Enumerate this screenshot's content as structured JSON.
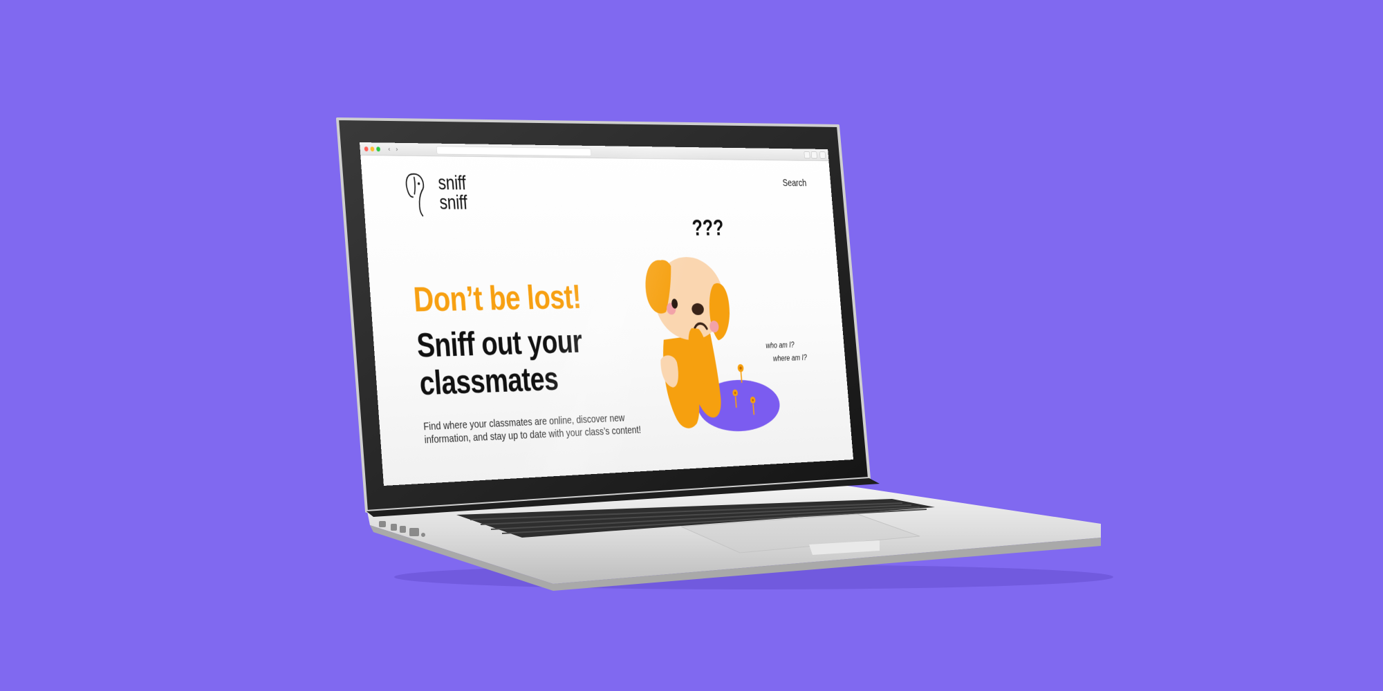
{
  "colors": {
    "background": "#8069F0",
    "accent_orange": "#F7A012",
    "pond_purple": "#7B5CF0",
    "headline_dark": "#111111"
  },
  "browser": {
    "icons": [
      "close-dot",
      "minimize-dot",
      "zoom-dot",
      "chevron-left-icon",
      "chevron-right-icon",
      "share-icon",
      "tabs-icon"
    ]
  },
  "site": {
    "logo": {
      "line1": "sniff",
      "line2": "sniff",
      "icon": "dog-outline-icon"
    },
    "nav": {
      "search": "Search"
    },
    "hero": {
      "headline_accent": "Don’t be lost!",
      "headline_line1": "Sniff out your",
      "headline_line2": "classmates",
      "description": "Find where your classmates are online, discover new information, and stay up to date with your class’s content!"
    },
    "illustration": {
      "question_marks": "???",
      "bubble1": "who am I?",
      "bubble2": "where am I?"
    }
  }
}
